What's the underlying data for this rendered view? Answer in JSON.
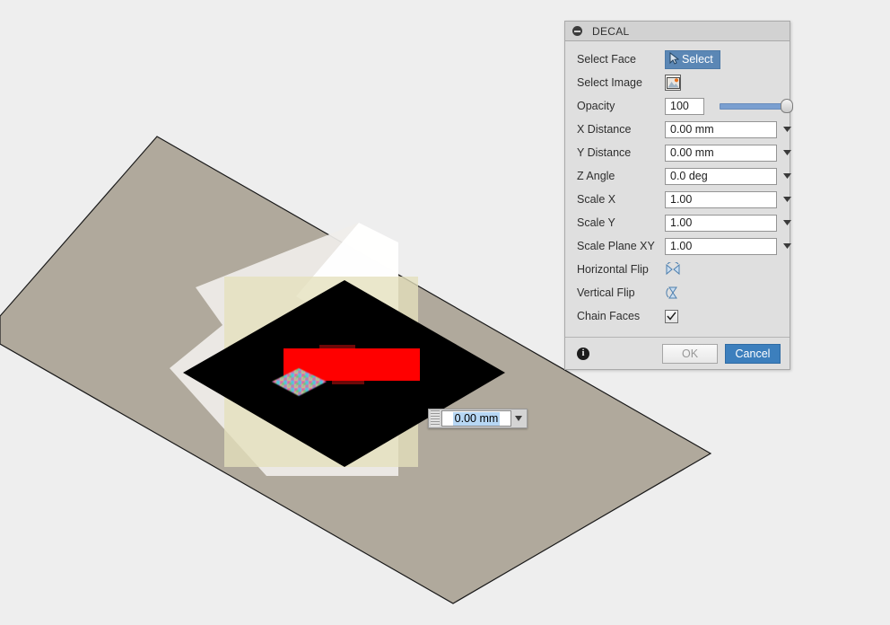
{
  "app": {
    "background_color": "#eeeeee"
  },
  "viewport": {
    "name": "3d-viewport",
    "colors": {
      "plane_tan": "#b0a99c",
      "plane_edge": "#000000",
      "sketch_white": "#ededed",
      "sketch_white_bright": "#fbfbfb",
      "decal_yellow": "#e8e6cf",
      "face_black": "#000000",
      "decal_red": "#ff0000"
    },
    "floating_input": {
      "name": "floating-distance-input",
      "value": "0.00 mm",
      "selected": true,
      "dropdown_arrow": "▼",
      "grip": "drag-grip"
    }
  },
  "panel": {
    "title": "DECAL",
    "collapse_icon": "minus-circle-icon",
    "rows": [
      {
        "id": "select-face",
        "label": "Select Face",
        "control": "button",
        "button_label": "Select",
        "icon": "cursor-arrow-icon",
        "active": true
      },
      {
        "id": "select-image",
        "label": "Select Image",
        "control": "icon-button",
        "icon": "image-picker-icon"
      },
      {
        "id": "opacity",
        "label": "Opacity",
        "control": "slider",
        "value": "100",
        "slider_percent": 100
      },
      {
        "id": "x-distance",
        "label": "X Distance",
        "control": "combo",
        "value": "0.00 mm"
      },
      {
        "id": "y-distance",
        "label": "Y Distance",
        "control": "combo",
        "value": "0.00 mm"
      },
      {
        "id": "z-angle",
        "label": "Z Angle",
        "control": "combo",
        "value": "0.0 deg"
      },
      {
        "id": "scale-x",
        "label": "Scale X",
        "control": "combo",
        "value": "1.00"
      },
      {
        "id": "scale-y",
        "label": "Scale Y",
        "control": "combo",
        "value": "1.00"
      },
      {
        "id": "scale-plane-xy",
        "label": "Scale Plane XY",
        "control": "combo",
        "value": "1.00"
      },
      {
        "id": "horizontal-flip",
        "label": "Horizontal Flip",
        "control": "icon-button",
        "icon": "horizontal-flip-icon"
      },
      {
        "id": "vertical-flip",
        "label": "Vertical Flip",
        "control": "icon-button",
        "icon": "vertical-flip-icon"
      },
      {
        "id": "chain-faces",
        "label": "Chain Faces",
        "control": "checkbox",
        "checked": true
      }
    ],
    "footer": {
      "info_icon": "info-icon",
      "info_glyph": "i",
      "ok_label": "OK",
      "ok_enabled": false,
      "cancel_label": "Cancel",
      "cancel_enabled": true
    },
    "colors": {
      "panel_bg": "#dfdfdf",
      "header_bg": "#d2d2d2",
      "accent_blue": "#3c7fbd",
      "select_blue": "#5b87b5",
      "slider_blue": "#7a9fd0"
    }
  }
}
